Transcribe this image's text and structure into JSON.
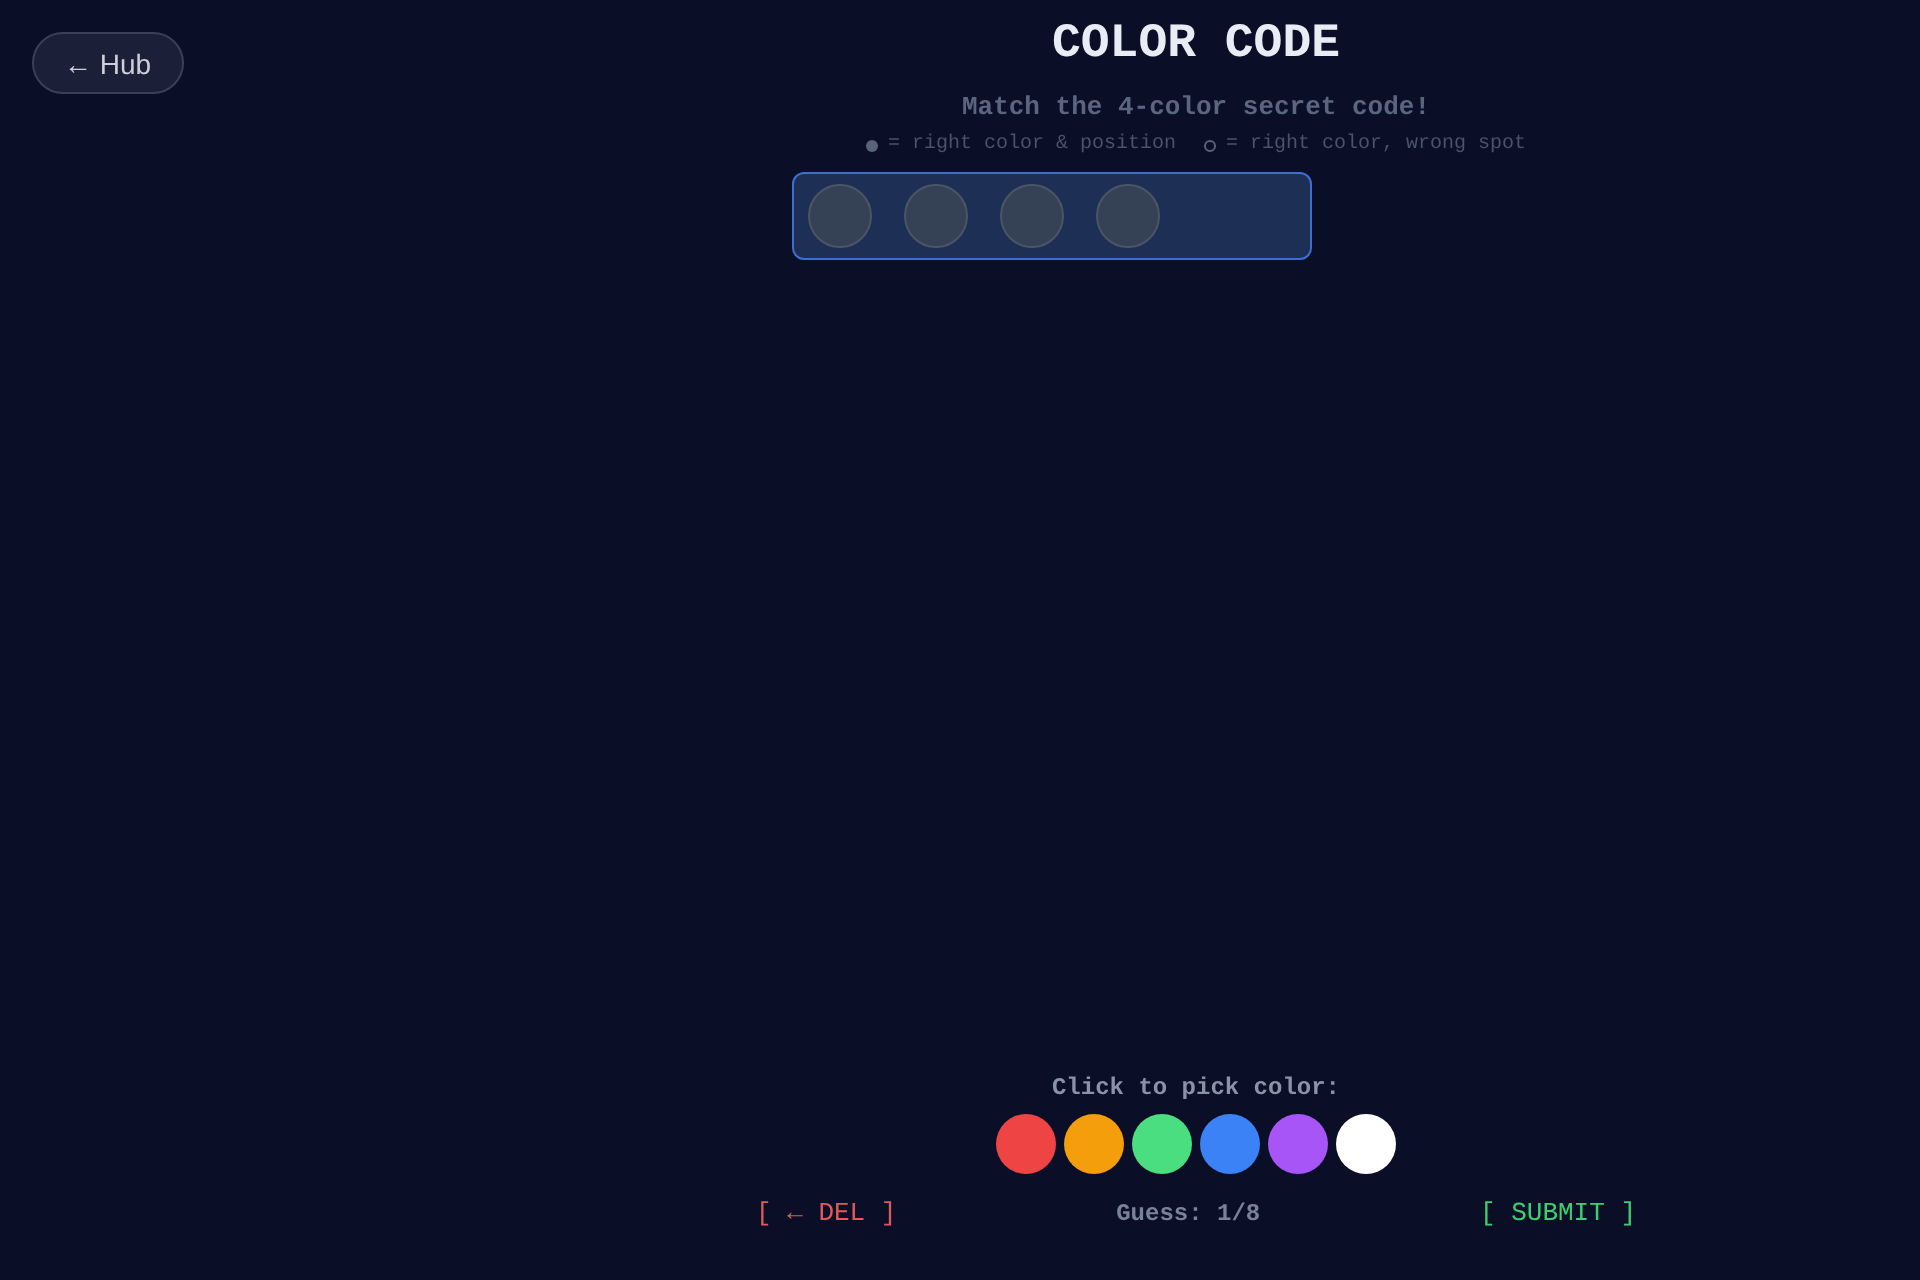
{
  "back_button": {
    "label": "← Hub"
  },
  "title": "COLOR CODE",
  "subtitle": "Match the 4-color secret code!",
  "legend": [
    {
      "kind": "filled",
      "text": "= right color & position"
    },
    {
      "kind": "hollow",
      "text": "= right color, wrong spot"
    }
  ],
  "guess_rows": [
    {
      "active": true,
      "pegs": [
        {
          "filled": false
        },
        {
          "filled": false
        },
        {
          "filled": false
        },
        {
          "filled": false
        }
      ]
    }
  ],
  "palette": {
    "label": "Click to pick color:",
    "colors": [
      {
        "color": "#ef4444"
      },
      {
        "color": "#f59e0b"
      },
      {
        "color": "#4ade80"
      },
      {
        "color": "#3b82f6"
      },
      {
        "color": "#a855f7"
      },
      {
        "color": "#ffffff"
      }
    ]
  },
  "controls": {
    "delete": "[ ← DEL ]",
    "guess_counter": "Guess: 1/8",
    "submit": "[ SUBMIT ]"
  }
}
